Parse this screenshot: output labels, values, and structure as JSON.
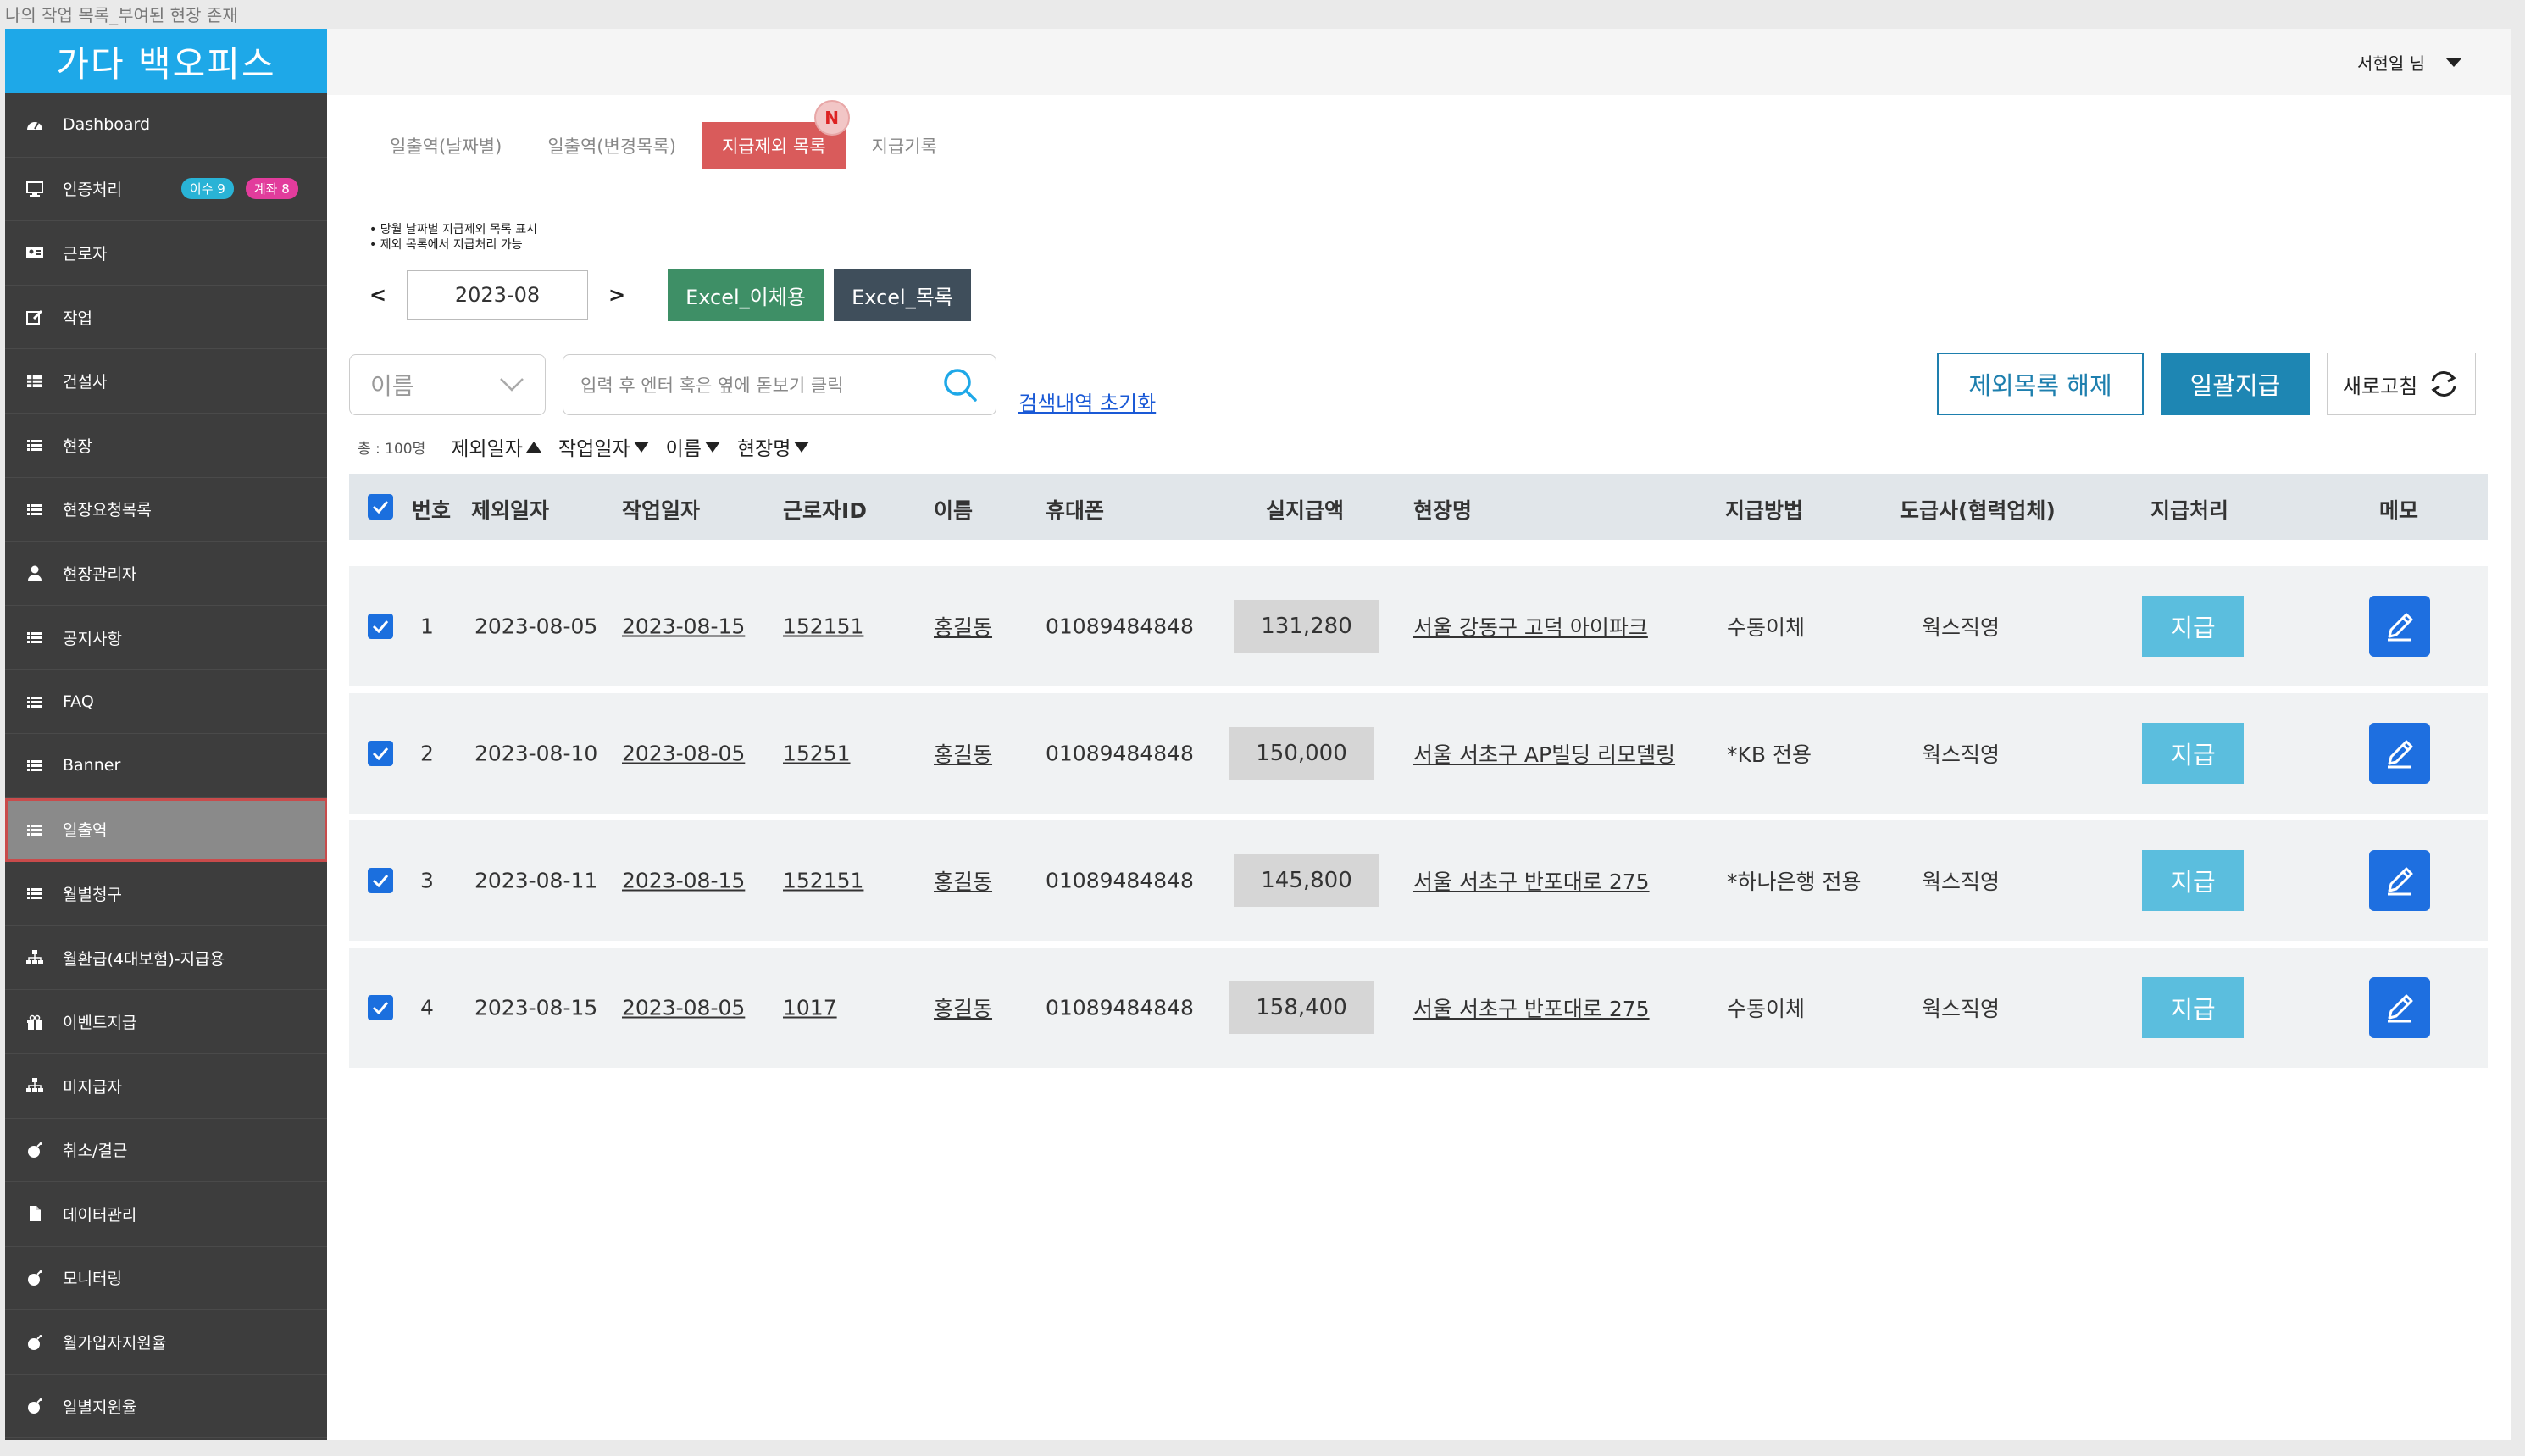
{
  "window_title": "나의 작업 목록_부여된 현장 존재",
  "brand": "가다 백오피스",
  "user": {
    "name": "서현일 님"
  },
  "sidebar": {
    "items": [
      {
        "label": "Dashboard",
        "icon": "dashboard-icon"
      },
      {
        "label": "인증처리",
        "icon": "monitor-icon",
        "badges": [
          "이수 9",
          "계좌 8"
        ]
      },
      {
        "label": "근로자",
        "icon": "id-card-icon"
      },
      {
        "label": "작업",
        "icon": "edit-icon"
      },
      {
        "label": "건설사",
        "icon": "table-icon"
      },
      {
        "label": "현장",
        "icon": "list-icon"
      },
      {
        "label": "현장요청목록",
        "icon": "list-icon"
      },
      {
        "label": "현장관리자",
        "icon": "user-icon"
      },
      {
        "label": "공지사항",
        "icon": "list-icon"
      },
      {
        "label": "FAQ",
        "icon": "list-icon"
      },
      {
        "label": "Banner",
        "icon": "list-icon"
      },
      {
        "label": "일출역",
        "icon": "list-icon",
        "active": true
      },
      {
        "label": "월별청구",
        "icon": "list-icon"
      },
      {
        "label": "월환급(4대보험)-지급용",
        "icon": "sitemap-icon"
      },
      {
        "label": "이벤트지급",
        "icon": "gift-icon"
      },
      {
        "label": "미지급자",
        "icon": "sitemap-icon"
      },
      {
        "label": "취소/결근",
        "icon": "bomb-icon"
      },
      {
        "label": "데이터관리",
        "icon": "file-icon"
      },
      {
        "label": "모니터링",
        "icon": "bomb-icon"
      },
      {
        "label": "월가입자지원율",
        "icon": "bomb-icon"
      },
      {
        "label": "일별지원율",
        "icon": "bomb-icon"
      }
    ]
  },
  "tabs": [
    {
      "label": "일출역(날짜별)"
    },
    {
      "label": "일출역(변경목록)"
    },
    {
      "label": "지급제외 목록",
      "active": true,
      "new_badge": "N"
    },
    {
      "label": "지급기록"
    }
  ],
  "notes": [
    "• 당월 날짜별 지급제외 목록 표시",
    "• 제외 목록에서 지급처리 가능"
  ],
  "date_nav": {
    "prev": "<",
    "month": "2023-08",
    "next": ">"
  },
  "excel_buttons": {
    "transfer": "Excel_이체용",
    "list": "Excel_목록"
  },
  "search": {
    "select_value": "이름",
    "placeholder": "입력 후 엔터 혹은 옆에 돋보기 클릭",
    "reset_link": "검색내역 초기화"
  },
  "actions": {
    "remove_exclusion": "제외목록 해제",
    "pay_all": "일괄지급",
    "refresh": "새로고침"
  },
  "sort": {
    "total": "총 : 100명",
    "items": [
      {
        "label": "제외일자",
        "dir": "up"
      },
      {
        "label": "작업일자",
        "dir": "down"
      },
      {
        "label": "이름",
        "dir": "down"
      },
      {
        "label": "현장명",
        "dir": "down"
      }
    ]
  },
  "table": {
    "headers": [
      "번호",
      "제외일자",
      "작업일자",
      "근로자ID",
      "이름",
      "휴대폰",
      "실지급액",
      "현장명",
      "지급방법",
      "도급사(협력업체)",
      "지급처리",
      "메모"
    ],
    "rows": [
      {
        "no": "1",
        "excluded_date": "2023-08-05",
        "work_date": "2023-08-15",
        "worker_id": "152151",
        "name": "홍길동",
        "phone": "01089484848",
        "amount": "131,280",
        "site": "서울 강동구 고덕 아이파크",
        "method": "수동이체",
        "contractor": "웍스직영",
        "pay_label": "지급"
      },
      {
        "no": "2",
        "excluded_date": "2023-08-10",
        "work_date": "2023-08-05",
        "worker_id": "15251",
        "name": "홍길동",
        "phone": "01089484848",
        "amount": "150,000",
        "site": "서울 서초구 AP빌딩 리모델링",
        "method": "*KB 전용",
        "contractor": "웍스직영",
        "pay_label": "지급"
      },
      {
        "no": "3",
        "excluded_date": "2023-08-11",
        "work_date": "2023-08-15",
        "worker_id": "152151",
        "name": "홍길동",
        "phone": "01089484848",
        "amount": "145,800",
        "site": "서울 서초구 반포대로 275",
        "method": "*하나은행 전용",
        "contractor": "웍스직영",
        "pay_label": "지급"
      },
      {
        "no": "4",
        "excluded_date": "2023-08-15",
        "work_date": "2023-08-05",
        "worker_id": "1017",
        "name": "홍길동",
        "phone": "01089484848",
        "amount": "158,400",
        "site": "서울 서초구 반포대로 275",
        "method": "수동이체",
        "contractor": "웍스직영",
        "pay_label": "지급"
      }
    ]
  },
  "colors": {
    "brand": "#1ea8e8",
    "active_tab": "#d95b5b",
    "primary": "#1e86b3",
    "pay": "#5bbede",
    "memo": "#1e6fe0"
  }
}
